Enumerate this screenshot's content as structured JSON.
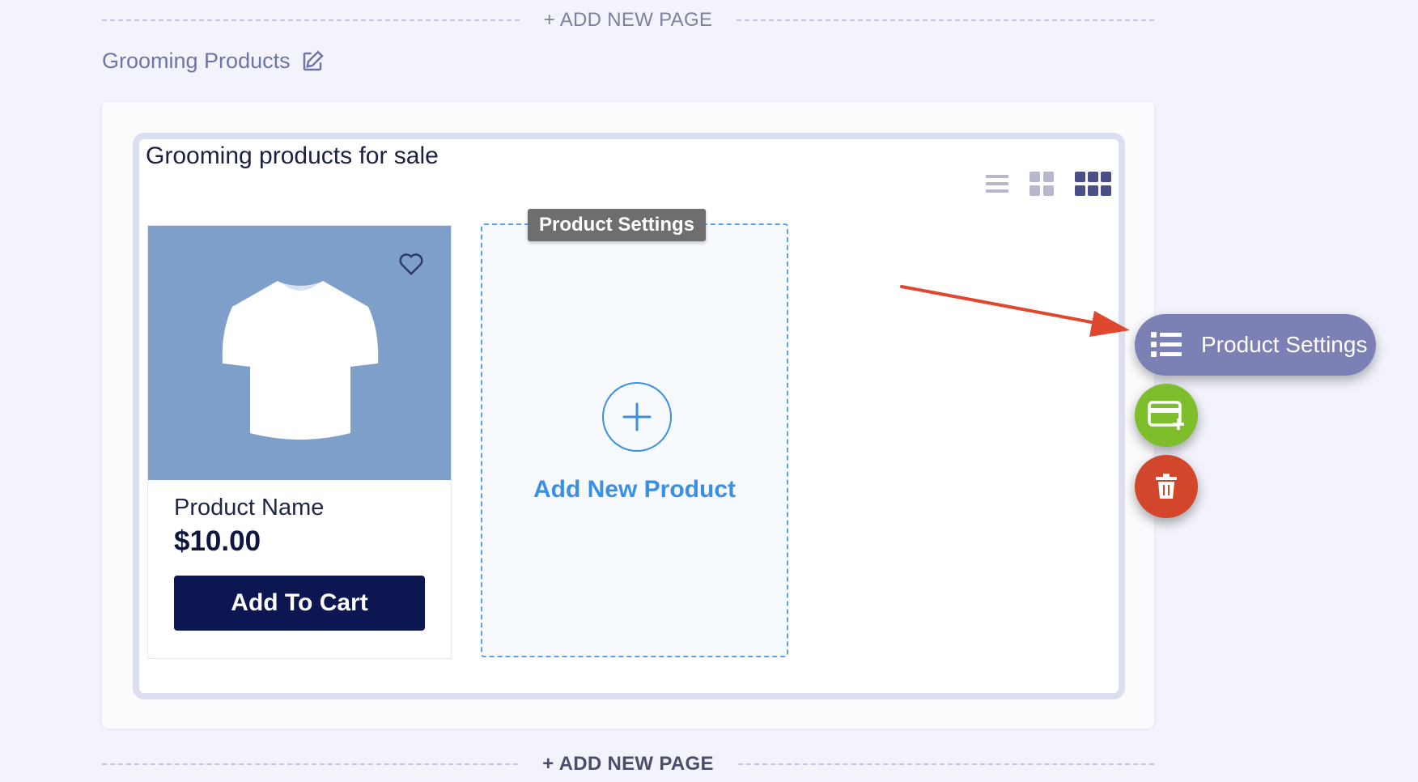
{
  "add_page": {
    "top_label": "+ ADD NEW PAGE",
    "bottom_label": "+ ADD NEW PAGE"
  },
  "page": {
    "title": "Grooming Products"
  },
  "section": {
    "title": "Grooming products for sale"
  },
  "product": {
    "name": "Product Name",
    "price": "$10.00",
    "cta": "Add To Cart"
  },
  "add_product": {
    "label": "Add New Product",
    "tooltip": "Product Settings"
  },
  "fab": {
    "settings_label": "Product Settings"
  },
  "colors": {
    "accent_blue": "#3b8fe3",
    "navy": "#0c1650",
    "fab_purple": "#7d80b4",
    "fab_green": "#7ebd2c",
    "fab_red": "#d2462c",
    "arrow_red": "#e0472f"
  }
}
